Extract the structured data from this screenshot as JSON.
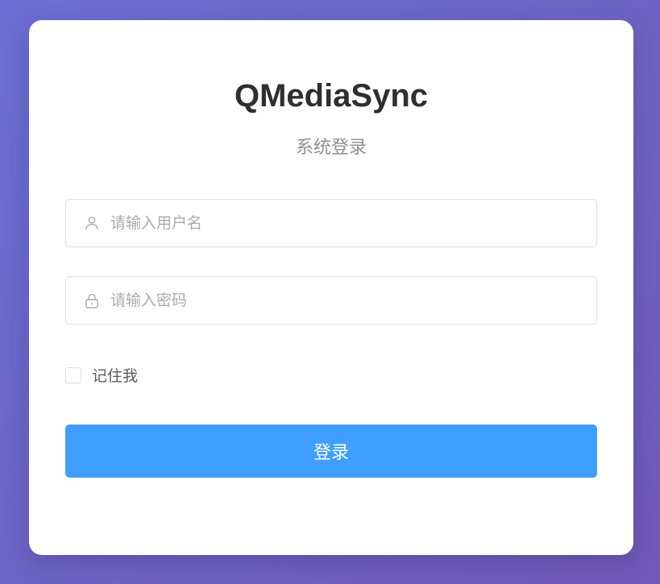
{
  "app": {
    "title": "QMediaSync",
    "subtitle": "系统登录"
  },
  "form": {
    "username": {
      "placeholder": "请输入用户名",
      "value": "",
      "icon": "user-icon"
    },
    "password": {
      "placeholder": "请输入密码",
      "value": "",
      "icon": "lock-icon"
    },
    "remember": {
      "label": "记住我",
      "checked": false
    },
    "submit_label": "登录"
  },
  "colors": {
    "primary": "#409eff",
    "background_start": "#6b6fd3",
    "background_end": "#7159b8",
    "title": "#2d2f33",
    "muted": "#8e9095",
    "border": "#dcdfe6"
  }
}
